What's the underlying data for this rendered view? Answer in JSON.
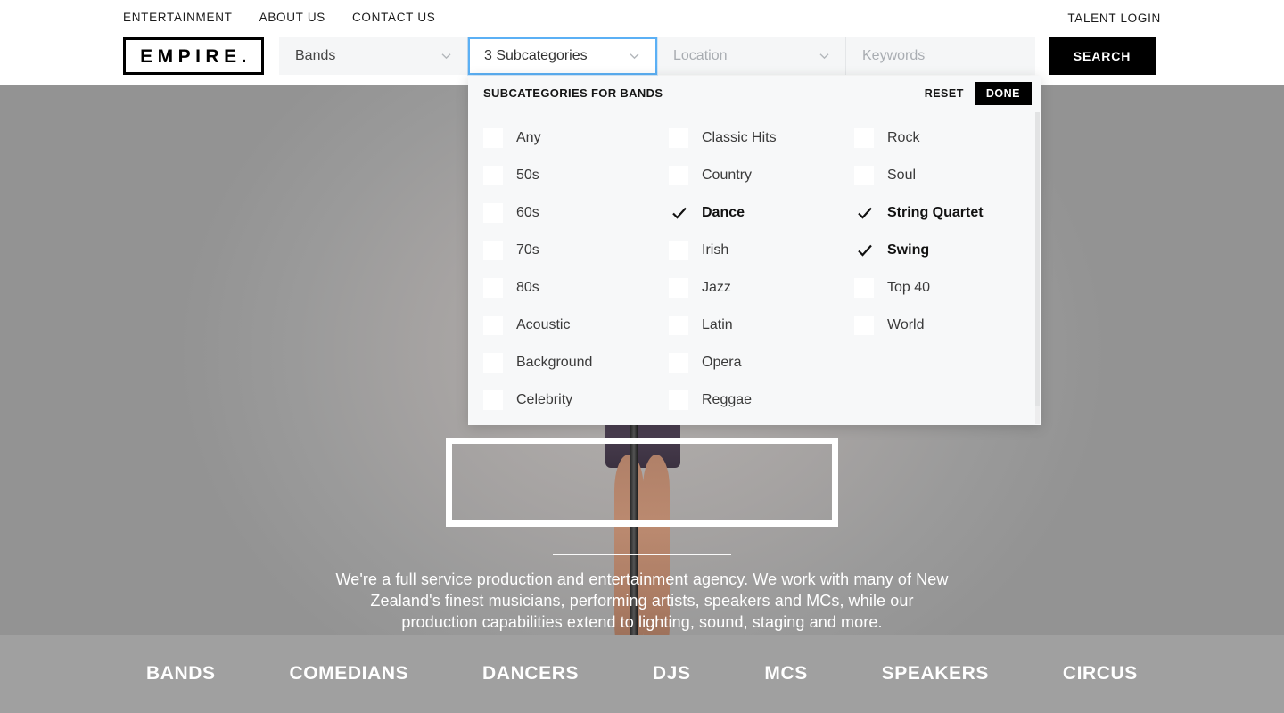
{
  "topnav": {
    "items": [
      {
        "label": "ENTERTAINMENT"
      },
      {
        "label": "ABOUT US"
      },
      {
        "label": "CONTACT US"
      }
    ],
    "talent_login": "TALENT LOGIN"
  },
  "brand": {
    "logo_text": "EMPIRE."
  },
  "search": {
    "category": {
      "value": "Bands",
      "is_placeholder": false
    },
    "subcategory": {
      "value": "3 Subcategories",
      "is_placeholder": false,
      "focused": true
    },
    "location": {
      "value": "Location",
      "is_placeholder": true
    },
    "keywords": {
      "value": "Keywords",
      "is_placeholder": true
    },
    "submit_label": "SEARCH"
  },
  "subcategory_panel": {
    "title": "SUBCATEGORIES FOR BANDS",
    "reset_label": "RESET",
    "done_label": "DONE",
    "columns": [
      {
        "options": [
          {
            "label": "Any",
            "checked": false
          },
          {
            "label": "50s",
            "checked": false
          },
          {
            "label": "60s",
            "checked": false
          },
          {
            "label": "70s",
            "checked": false
          },
          {
            "label": "80s",
            "checked": false
          },
          {
            "label": "Acoustic",
            "checked": false
          },
          {
            "label": "Background",
            "checked": false
          },
          {
            "label": "Celebrity",
            "checked": false
          }
        ]
      },
      {
        "options": [
          {
            "label": "Classic Hits",
            "checked": false
          },
          {
            "label": "Country",
            "checked": false
          },
          {
            "label": "Dance",
            "checked": true
          },
          {
            "label": "Irish",
            "checked": false
          },
          {
            "label": "Jazz",
            "checked": false
          },
          {
            "label": "Latin",
            "checked": false
          },
          {
            "label": "Opera",
            "checked": false
          },
          {
            "label": "Reggae",
            "checked": false
          }
        ]
      },
      {
        "options": [
          {
            "label": "Rock",
            "checked": false
          },
          {
            "label": "Soul",
            "checked": false
          },
          {
            "label": "String Quartet",
            "checked": true
          },
          {
            "label": "Swing",
            "checked": true
          },
          {
            "label": "Top 40",
            "checked": false
          },
          {
            "label": "World",
            "checked": false
          }
        ]
      }
    ],
    "selected_count": 3
  },
  "hero": {
    "body": "We're a full service production and entertainment agency. We work with many of New Zealand's finest musicians, performing artists, speakers and MCs, while our production capabilities extend to lighting, sound, staging and more."
  },
  "category_nav": {
    "items": [
      {
        "label": "BANDS"
      },
      {
        "label": "COMEDIANS"
      },
      {
        "label": "DANCERS"
      },
      {
        "label": "DJS"
      },
      {
        "label": "MCS"
      },
      {
        "label": "SPEAKERS"
      },
      {
        "label": "CIRCUS"
      }
    ]
  },
  "colors": {
    "focus_blue": "#5bb0f5",
    "accent_black": "#000000",
    "hero_gray": "#a0a0a0",
    "field_gray": "#f5f6f7",
    "panel_gray": "#f7f8f9"
  }
}
